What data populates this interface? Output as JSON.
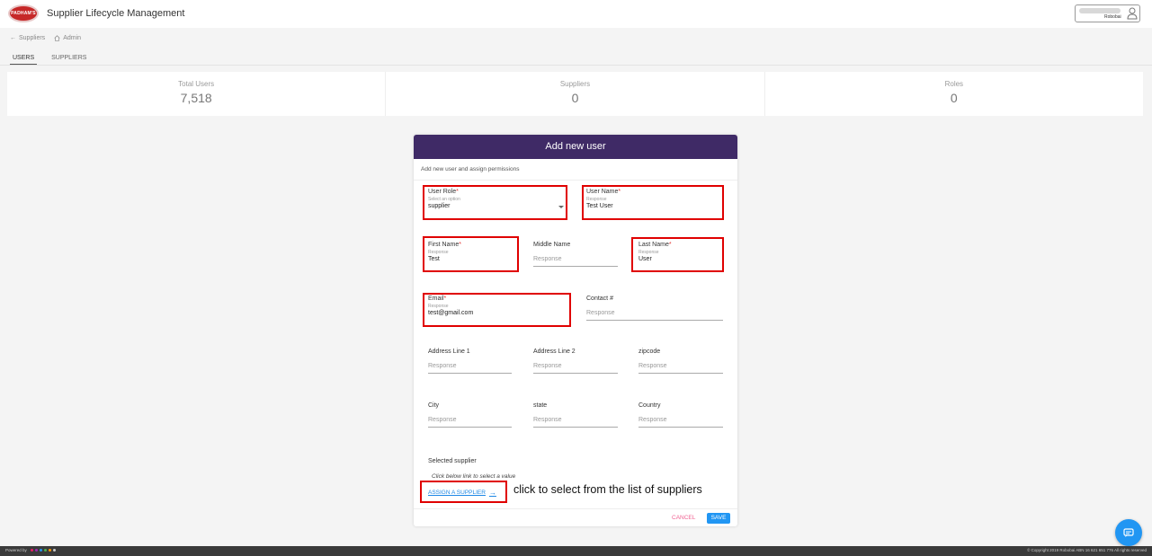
{
  "header": {
    "logo_text": "PADHAM'S",
    "app_title": "Supplier Lifecycle Management",
    "user_org": "Robobai"
  },
  "breadcrumb": {
    "back_label": "Suppliers",
    "home_label": "Admin"
  },
  "tabs": [
    {
      "label": "USERS",
      "active": true
    },
    {
      "label": "SUPPLIERS",
      "active": false
    }
  ],
  "stats": [
    {
      "label": "Total Users",
      "value": "7,518"
    },
    {
      "label": "Suppliers",
      "value": "0"
    },
    {
      "label": "Roles",
      "value": "0"
    }
  ],
  "modal": {
    "title": "Add new user",
    "subtitle": "Add new user and assign permissions",
    "fields": {
      "user_role": {
        "label": "User Role",
        "hint": "Select an option",
        "value": "supplier"
      },
      "user_name": {
        "label": "User Name",
        "hint": "Response",
        "value": "Test User"
      },
      "first_name": {
        "label": "First Name",
        "hint": "Response",
        "value": "Test"
      },
      "middle_name": {
        "label": "Middle Name",
        "placeholder": "Response"
      },
      "last_name": {
        "label": "Last Name",
        "hint": "Response",
        "value": "User"
      },
      "email": {
        "label": "Email",
        "hint": "Response",
        "value": "test@gmail.com"
      },
      "contact": {
        "label": "Contact #",
        "placeholder": "Response"
      },
      "address1": {
        "label": "Address Line 1",
        "placeholder": "Response"
      },
      "address2": {
        "label": "Address Line 2",
        "placeholder": "Response"
      },
      "zipcode": {
        "label": "zipcode",
        "placeholder": "Response"
      },
      "city": {
        "label": "City",
        "placeholder": "Response"
      },
      "state": {
        "label": "state",
        "placeholder": "Response"
      },
      "country": {
        "label": "Country",
        "placeholder": "Response"
      }
    },
    "required_mark": "*",
    "selected_supplier_label": "Selected supplier",
    "selected_supplier_hint": "Click below link to select a value",
    "assign_link": "ASSIGN A SUPPLIER",
    "cancel_label": "CANCEL",
    "save_label": "SAVE"
  },
  "annotation": "click to select from the list of suppliers",
  "footer": {
    "powered_by": "Powered by",
    "copyright": "© Copyright 2019 Robobai ABN 16 621 651 776 All rights reserved"
  },
  "colors": {
    "modal_header": "#3f2a66",
    "highlight": "#e00000",
    "primary": "#2196f3",
    "cancel": "#f06292"
  }
}
